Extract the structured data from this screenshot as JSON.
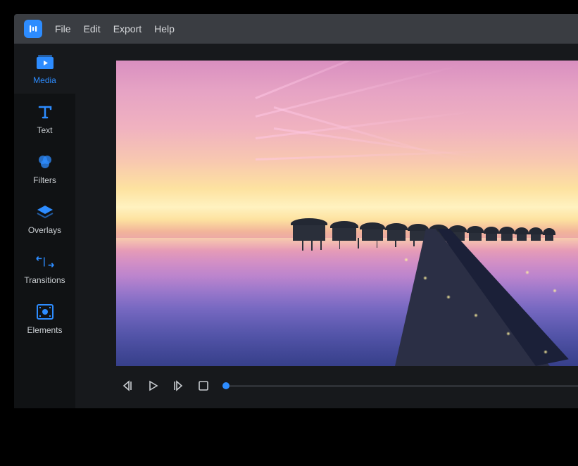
{
  "menubar": {
    "items": [
      "File",
      "Edit",
      "Export",
      "Help"
    ]
  },
  "sidebar": {
    "items": [
      {
        "id": "media",
        "label": "Media",
        "icon": "media-icon",
        "active": true
      },
      {
        "id": "text",
        "label": "Text",
        "icon": "text-icon",
        "active": false
      },
      {
        "id": "filters",
        "label": "Filters",
        "icon": "filters-icon",
        "active": false
      },
      {
        "id": "overlays",
        "label": "Overlays",
        "icon": "overlays-icon",
        "active": false
      },
      {
        "id": "transitions",
        "label": "Transitions",
        "icon": "transitions-icon",
        "active": false
      },
      {
        "id": "elements",
        "label": "Elements",
        "icon": "elements-icon",
        "active": false
      }
    ]
  },
  "playback": {
    "buttons": [
      "prev",
      "play",
      "next",
      "stop"
    ],
    "progress": 0
  },
  "colors": {
    "accent": "#2d8cff",
    "bg_dark": "#101214",
    "bg_panel": "#17191c",
    "bg_menubar": "#3a3d42"
  }
}
